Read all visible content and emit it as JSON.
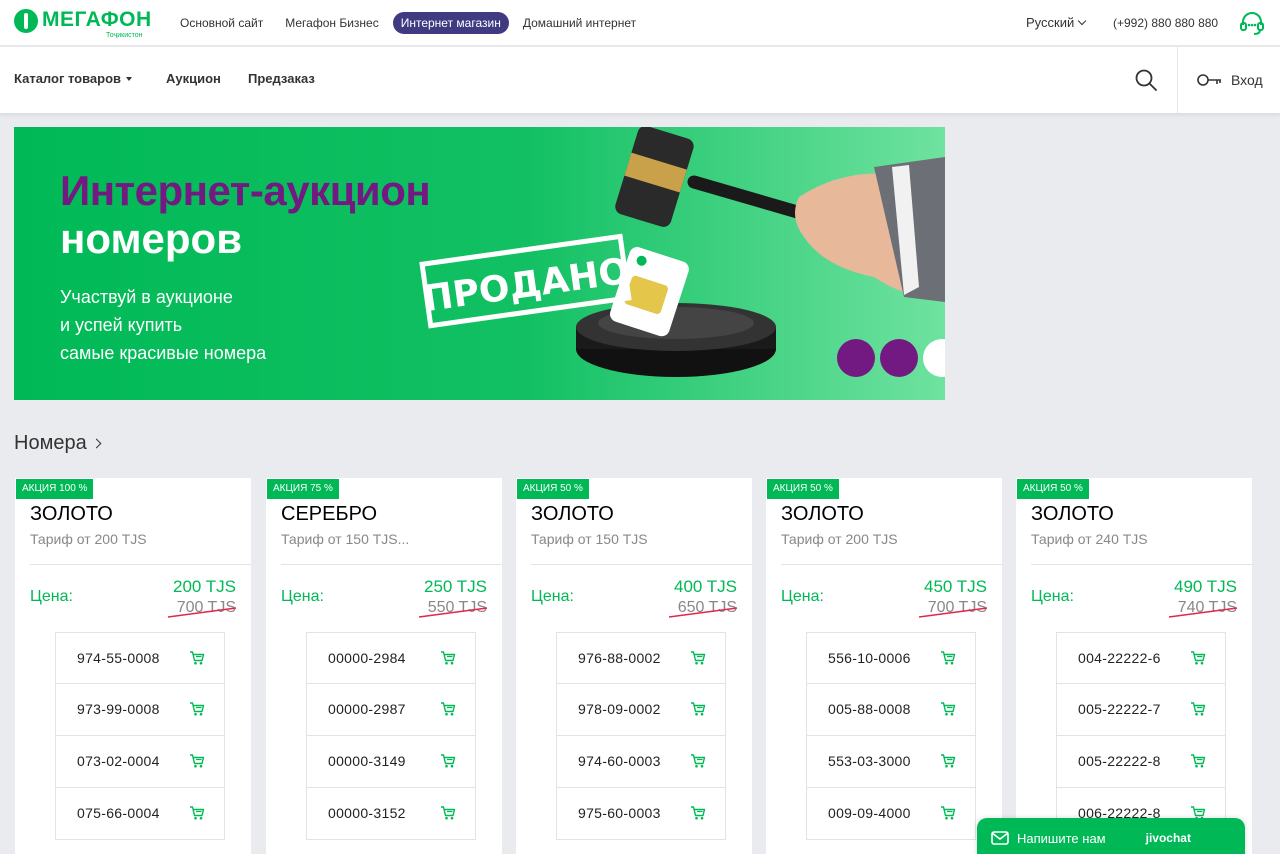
{
  "header": {
    "logo_text": "МЕГАФОН",
    "logo_sub": "Тоҷикистон",
    "top_links": [
      {
        "label": "Основной сайт",
        "active": false
      },
      {
        "label": "Мегафон Бизнес",
        "active": false
      },
      {
        "label": "Интернет магазин",
        "active": true
      },
      {
        "label": "Домашний интернет",
        "active": false
      }
    ],
    "language": "Русский",
    "phone": "(+992) 880 880 880"
  },
  "nav": {
    "catalog": "Каталог товаров",
    "auction": "Аукцион",
    "preorder": "Предзаказ",
    "login": "Вход"
  },
  "banner": {
    "title_line1": "Интернет-аукцион",
    "title_line2": "номеров",
    "sub_line1": "Участвуй в аукционе",
    "sub_line2": "и успей купить",
    "sub_line3": "самые красивые номера",
    "stamp": "ПРОДАНО"
  },
  "section": {
    "title": "Номера"
  },
  "cards": [
    {
      "badge": "АКЦИЯ 100 %",
      "title": "ЗОЛОТО",
      "tariff": "Тариф от 200 TJS",
      "price_label": "Цена:",
      "price_new": "200 TJS",
      "price_old": "700 TJS",
      "numbers": [
        "974-55-0008",
        "973-99-0008",
        "073-02-0004",
        "075-66-0004"
      ]
    },
    {
      "badge": "АКЦИЯ 75 %",
      "title": "СЕРЕБРО",
      "tariff": "Тариф от 150 TJS...",
      "price_label": "Цена:",
      "price_new": "250 TJS",
      "price_old": "550 TJS",
      "numbers": [
        "00000-2984",
        "00000-2987",
        "00000-3149",
        "00000-3152"
      ]
    },
    {
      "badge": "АКЦИЯ 50 %",
      "title": "ЗОЛОТО",
      "tariff": "Тариф от 150 TJS",
      "price_label": "Цена:",
      "price_new": "400 TJS",
      "price_old": "650 TJS",
      "numbers": [
        "976-88-0002",
        "978-09-0002",
        "974-60-0003",
        "975-60-0003"
      ]
    },
    {
      "badge": "АКЦИЯ 50 %",
      "title": "ЗОЛОТО",
      "tariff": "Тариф от 200 TJS",
      "price_label": "Цена:",
      "price_new": "450 TJS",
      "price_old": "700 TJS",
      "numbers": [
        "556-10-0006",
        "005-88-0008",
        "553-03-3000",
        "009-09-4000"
      ]
    },
    {
      "badge": "АКЦИЯ 50 %",
      "title": "ЗОЛОТО",
      "tariff": "Тариф от 240 TJS",
      "price_label": "Цена:",
      "price_new": "490 TJS",
      "price_old": "740 TJS",
      "numbers": [
        "004-22222-6",
        "005-22222-7",
        "005-22222-8",
        "006-22222-8"
      ]
    }
  ],
  "chat": {
    "label": "Напишите нам",
    "brand": "jivochat"
  },
  "colors": {
    "brand_green": "#00b956",
    "brand_purple": "#731982",
    "active_pill": "#3f3a82",
    "strike_red": "#e0284b"
  },
  "icons": [
    "support-icon",
    "search-icon",
    "key-icon",
    "cart-icon",
    "chat-icon",
    "chevron-right-icon",
    "caret-down-icon"
  ]
}
